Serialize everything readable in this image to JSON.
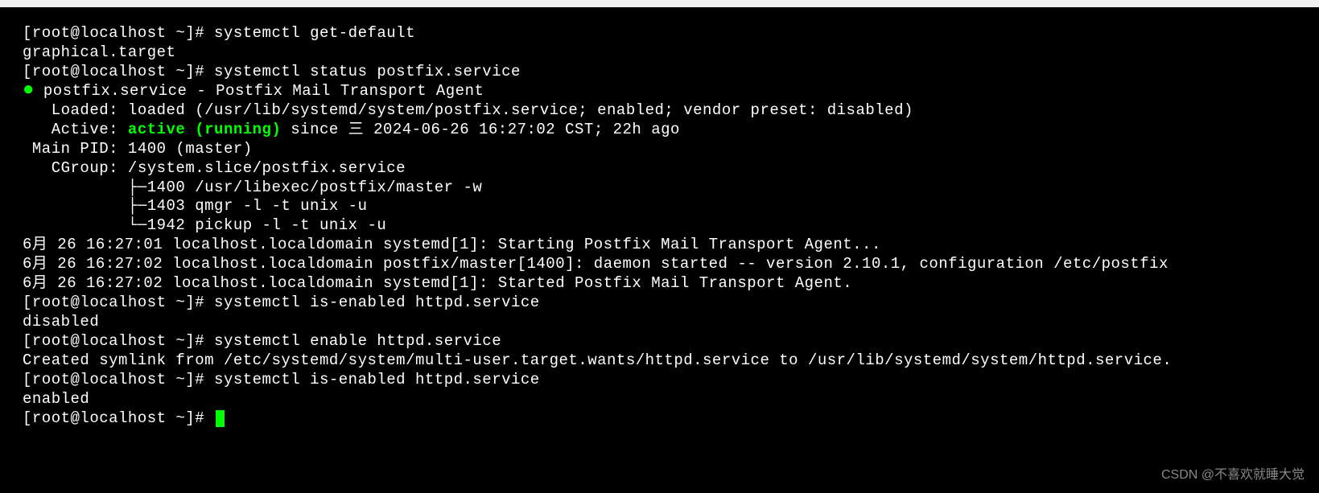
{
  "prompts": {
    "p1": "[root@localhost ~]# ",
    "p2": "[root@localhost ~]# ",
    "p3": "[root@localhost ~]# ",
    "p4": "[root@localhost ~]# ",
    "p5": "[root@localhost ~]# ",
    "p6": "[root@localhost ~]# "
  },
  "commands": {
    "c1": "systemctl get-default",
    "c2": "systemctl status postfix.service",
    "c3": "systemctl is-enabled httpd.service",
    "c4": "systemctl enable httpd.service",
    "c5": "systemctl is-enabled httpd.service"
  },
  "output": {
    "o1": "graphical.target",
    "status_header_pre": " postfix.service - Postfix Mail Transport Agent",
    "loaded": "   Loaded: loaded (/usr/lib/systemd/system/postfix.service; enabled; vendor preset: disabled)",
    "active_pre": "   Active: ",
    "active_green": "active (running)",
    "active_post": " since 三 2024-06-26 16:27:02 CST; 22h ago",
    "mainpid": " Main PID: 1400 (master)",
    "cgroup": "   CGroup: /system.slice/postfix.service",
    "cg1": "           ├─1400 /usr/libexec/postfix/master -w",
    "cg2": "           ├─1403 qmgr -l -t unix -u",
    "cg3": "           └─1942 pickup -l -t unix -u",
    "blank": "",
    "log1": "6月 26 16:27:01 localhost.localdomain systemd[1]: Starting Postfix Mail Transport Agent...",
    "log2": "6月 26 16:27:02 localhost.localdomain postfix/master[1400]: daemon started -- version 2.10.1, configuration /etc/postfix",
    "log3": "6月 26 16:27:02 localhost.localdomain systemd[1]: Started Postfix Mail Transport Agent.",
    "o3": "disabled",
    "o4": "Created symlink from /etc/systemd/system/multi-user.target.wants/httpd.service to /usr/lib/systemd/system/httpd.service.",
    "o5": "enabled"
  },
  "watermark": "CSDN @不喜欢就睡大觉"
}
